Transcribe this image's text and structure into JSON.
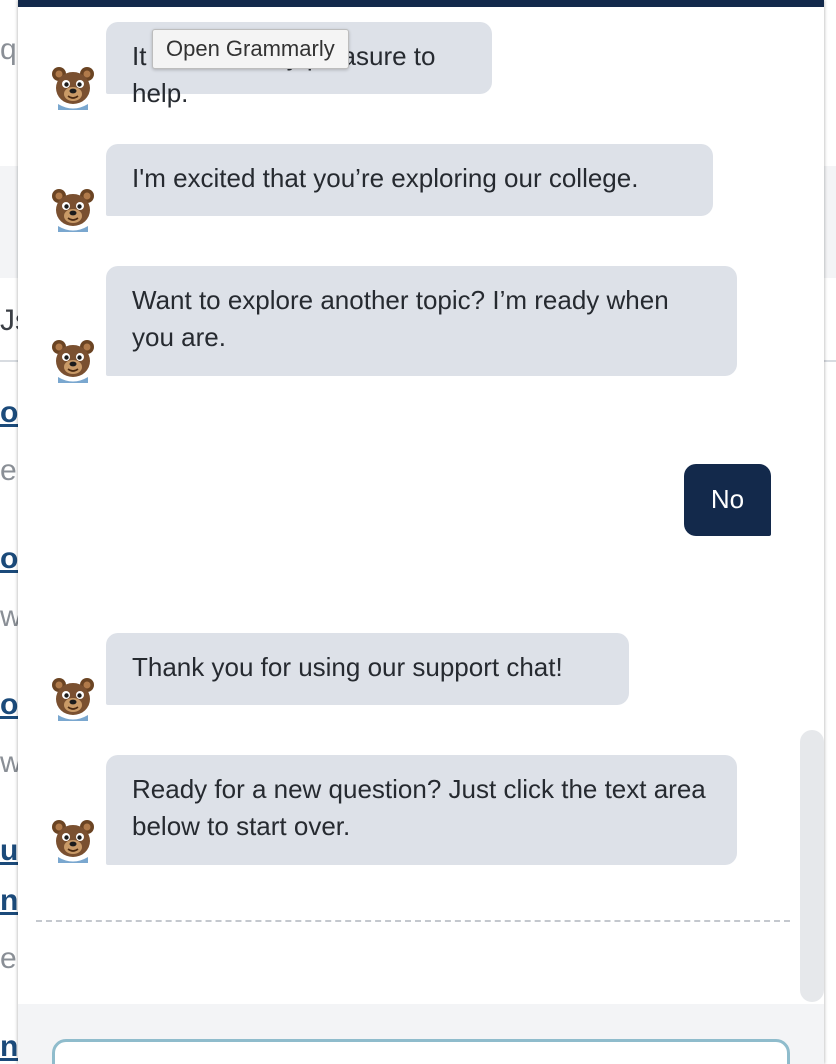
{
  "background_page": {
    "fragments": [
      "q",
      "Js",
      "o",
      "e",
      "o",
      "w",
      "o",
      "w",
      "ut",
      "n",
      "e",
      "n"
    ]
  },
  "tooltip": {
    "label": "Open Grammarly"
  },
  "chat": {
    "bot_avatar_icon": "bear-mascot-icon",
    "messages": [
      {
        "from": "bot",
        "text": "It would be my pleasure to help."
      },
      {
        "from": "bot",
        "text": "I'm excited that you’re exploring our college."
      },
      {
        "from": "bot",
        "text": "Want to explore another topic? I’m ready when you are."
      },
      {
        "from": "user",
        "text": "No"
      },
      {
        "from": "bot",
        "text": "Thank you for using our support chat!"
      },
      {
        "from": "bot",
        "text": "Ready for a new question? Just click the text area below to start over."
      }
    ]
  },
  "composer": {
    "placeholder": ""
  },
  "colors": {
    "header_bar": "#13294b",
    "bot_bubble": "#dde1e8",
    "user_bubble": "#13294b",
    "input_border": "#8fbccc"
  }
}
